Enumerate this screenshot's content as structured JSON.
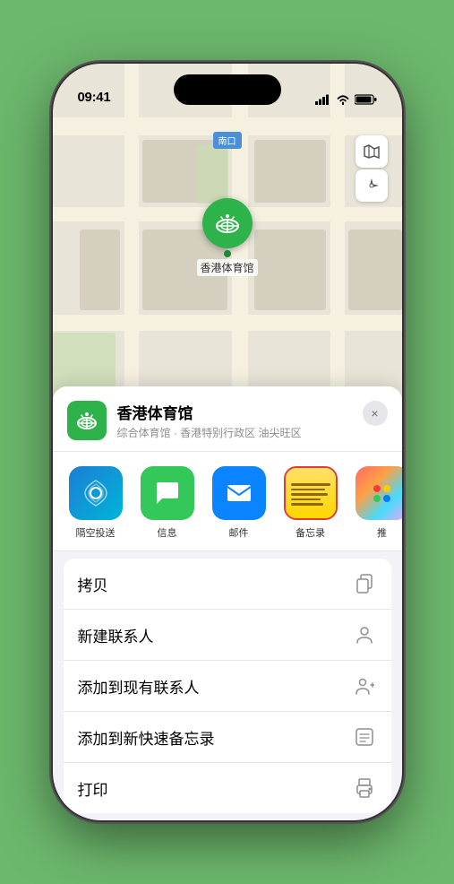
{
  "status_bar": {
    "time": "09:41",
    "location_icon": "▶",
    "signal": "●●●●",
    "wifi": "wifi",
    "battery": "battery"
  },
  "map": {
    "label": "南口",
    "pin_name": "香港体育馆",
    "pin_label": "香港体育馆"
  },
  "venue": {
    "name": "香港体育馆",
    "description": "综合体育馆 · 香港特别行政区 油尖旺区",
    "close_label": "×"
  },
  "share_apps": [
    {
      "id": "airdrop",
      "label": "隔空投送",
      "type": "airdrop"
    },
    {
      "id": "messages",
      "label": "信息",
      "type": "messages"
    },
    {
      "id": "mail",
      "label": "邮件",
      "type": "mail"
    },
    {
      "id": "notes",
      "label": "备忘录",
      "type": "notes"
    },
    {
      "id": "more",
      "label": "推",
      "type": "more"
    }
  ],
  "actions": [
    {
      "label": "拷贝",
      "icon": "copy"
    },
    {
      "label": "新建联系人",
      "icon": "person"
    },
    {
      "label": "添加到现有联系人",
      "icon": "person-add"
    },
    {
      "label": "添加到新快速备忘录",
      "icon": "note"
    },
    {
      "label": "打印",
      "icon": "print"
    }
  ]
}
